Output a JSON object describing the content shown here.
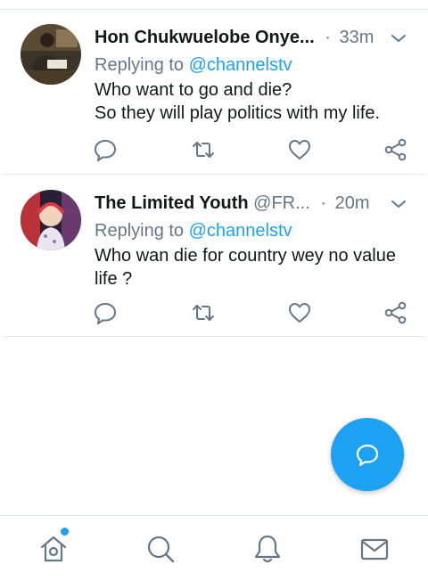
{
  "colors": {
    "accent": "#1da1f2",
    "text_primary": "#14171a",
    "text_secondary": "#657786",
    "divider": "#e1e8ed"
  },
  "tweets": [
    {
      "name": "Hon Chukwuelobe Onye...",
      "handle": "",
      "time": "33m",
      "replying_prefix": "Replying to",
      "replying_to": "@channelstv",
      "lines": [
        "Who want to go and die?",
        "So they will play politics with my life."
      ],
      "icons": [
        "reply-icon",
        "retweet-icon",
        "like-icon",
        "share-icon"
      ]
    },
    {
      "name": "The Limited Youth",
      "handle": "@FR...",
      "time": "20m",
      "replying_prefix": "Replying to",
      "replying_to": "@channelstv",
      "lines": [
        "Who wan die for country wey no value life ?"
      ],
      "icons": [
        "reply-icon",
        "retweet-icon",
        "like-icon",
        "share-icon"
      ]
    }
  ],
  "fab": {
    "icon": "compose-reply-icon"
  },
  "bottom_nav": [
    {
      "name": "home",
      "icon": "home-icon",
      "has_notification_dot": true
    },
    {
      "name": "search",
      "icon": "search-icon"
    },
    {
      "name": "notifications",
      "icon": "bell-icon"
    },
    {
      "name": "messages",
      "icon": "mail-icon"
    }
  ]
}
